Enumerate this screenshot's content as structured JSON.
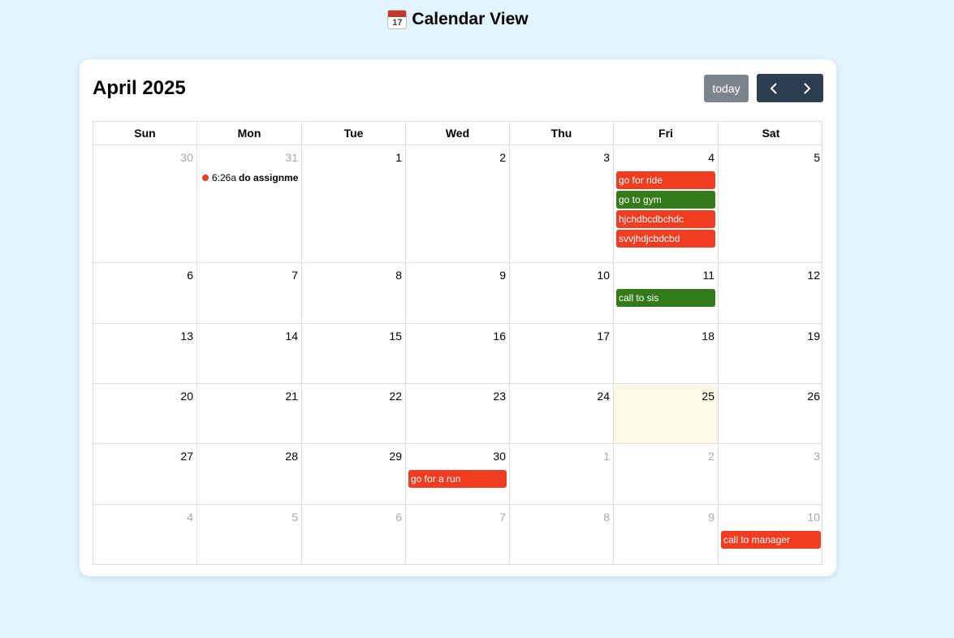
{
  "page": {
    "title": "Calendar View",
    "icon_day": "17"
  },
  "toolbar": {
    "month_title": "April 2025",
    "today_label": "today",
    "prev_icon": "chevron-left-icon",
    "next_icon": "chevron-right-icon"
  },
  "colors": {
    "red": "#f03c20",
    "green": "#337a1b",
    "today_bg": "#fef9e6",
    "nav_bg": "#2c3e50",
    "today_btn_bg": "#7c858d"
  },
  "weekdays": [
    "Sun",
    "Mon",
    "Tue",
    "Wed",
    "Thu",
    "Fri",
    "Sat"
  ],
  "weeks": [
    {
      "days": [
        {
          "num": "30",
          "other": true,
          "events": []
        },
        {
          "num": "31",
          "other": true,
          "events": [
            {
              "style": "dot",
              "time": "6:26a",
              "title": "do assignment",
              "color": "red"
            }
          ]
        },
        {
          "num": "1",
          "events": []
        },
        {
          "num": "2",
          "events": []
        },
        {
          "num": "3",
          "events": []
        },
        {
          "num": "4",
          "events": [
            {
              "style": "block",
              "title": "go for ride",
              "color": "red"
            },
            {
              "style": "block",
              "title": "go to gym",
              "color": "green"
            },
            {
              "style": "block",
              "title": "hjchdbcdbchdc",
              "color": "red"
            },
            {
              "style": "block",
              "title": "svvjhdjcbdcbd",
              "color": "red"
            }
          ]
        },
        {
          "num": "5",
          "events": []
        }
      ]
    },
    {
      "days": [
        {
          "num": "6",
          "events": []
        },
        {
          "num": "7",
          "events": []
        },
        {
          "num": "8",
          "events": []
        },
        {
          "num": "9",
          "events": []
        },
        {
          "num": "10",
          "events": []
        },
        {
          "num": "11",
          "events": [
            {
              "style": "block",
              "title": "call to sis",
              "color": "green"
            }
          ]
        },
        {
          "num": "12",
          "events": []
        }
      ]
    },
    {
      "days": [
        {
          "num": "13",
          "events": []
        },
        {
          "num": "14",
          "events": []
        },
        {
          "num": "15",
          "events": []
        },
        {
          "num": "16",
          "events": []
        },
        {
          "num": "17",
          "events": []
        },
        {
          "num": "18",
          "events": []
        },
        {
          "num": "19",
          "events": []
        }
      ]
    },
    {
      "days": [
        {
          "num": "20",
          "events": []
        },
        {
          "num": "21",
          "events": []
        },
        {
          "num": "22",
          "events": []
        },
        {
          "num": "23",
          "events": []
        },
        {
          "num": "24",
          "events": []
        },
        {
          "num": "25",
          "today": true,
          "events": []
        },
        {
          "num": "26",
          "events": []
        }
      ]
    },
    {
      "days": [
        {
          "num": "27",
          "events": []
        },
        {
          "num": "28",
          "events": []
        },
        {
          "num": "29",
          "events": []
        },
        {
          "num": "30",
          "events": [
            {
              "style": "block",
              "title": "go for a run",
              "color": "red"
            }
          ]
        },
        {
          "num": "1",
          "other": true,
          "events": []
        },
        {
          "num": "2",
          "other": true,
          "events": []
        },
        {
          "num": "3",
          "other": true,
          "events": []
        }
      ]
    },
    {
      "days": [
        {
          "num": "4",
          "other": true,
          "events": []
        },
        {
          "num": "5",
          "other": true,
          "events": []
        },
        {
          "num": "6",
          "other": true,
          "events": []
        },
        {
          "num": "7",
          "other": true,
          "events": []
        },
        {
          "num": "8",
          "other": true,
          "events": []
        },
        {
          "num": "9",
          "other": true,
          "events": []
        },
        {
          "num": "10",
          "other": true,
          "events": [
            {
              "style": "block",
              "title": "call to manager",
              "color": "red"
            }
          ]
        }
      ]
    }
  ]
}
